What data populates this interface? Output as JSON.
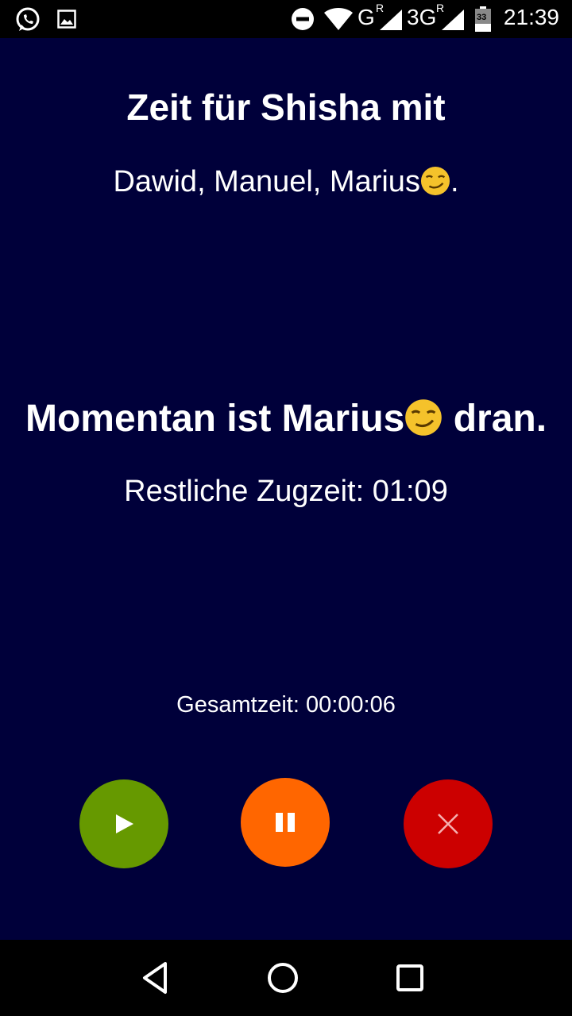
{
  "status_bar": {
    "time": "21:39",
    "network_1": "G",
    "network_2": "3G",
    "roaming_mark": "R",
    "battery_level": "33",
    "icons": [
      "whatsapp-icon",
      "image-icon",
      "dnd-icon",
      "wifi-icon",
      "signal-icon",
      "signal-icon",
      "battery-icon"
    ]
  },
  "main": {
    "title": "Zeit für Shisha mit",
    "participants": "Dawid, Manuel, Marius",
    "participants_suffix": ".",
    "current_prefix": "Momentan ist Marius",
    "current_suffix": " dran.",
    "remaining_label": "Restliche Zugzeit: 01:09",
    "total_label": "Gesamtzeit: 00:00:06",
    "emoji": "smirking-face-emoji"
  },
  "controls": {
    "play": {
      "icon": "play-icon",
      "color": "#669900"
    },
    "pause": {
      "icon": "pause-icon",
      "color": "#ff6600"
    },
    "stop": {
      "icon": "close-icon",
      "color": "#cc0000"
    }
  },
  "nav_bar": {
    "back": "back-icon",
    "home": "home-icon",
    "recent": "recent-apps-icon"
  },
  "colors": {
    "background": "#00003a",
    "text": "#ffffff"
  }
}
